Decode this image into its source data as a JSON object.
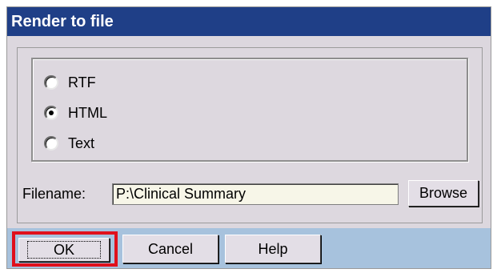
{
  "dialog": {
    "title": "Render to file",
    "options": [
      {
        "label": "RTF",
        "checked": false
      },
      {
        "label": "HTML",
        "checked": true
      },
      {
        "label": "Text",
        "checked": false
      }
    ],
    "filename_label": "Filename:",
    "filename_value": "P:\\Clinical Summary",
    "browse_label": "Browse",
    "ok_label": "OK",
    "cancel_label": "Cancel",
    "help_label": "Help",
    "highlight_color": "#e0101c",
    "title_bar_color": "#1f3f87"
  }
}
